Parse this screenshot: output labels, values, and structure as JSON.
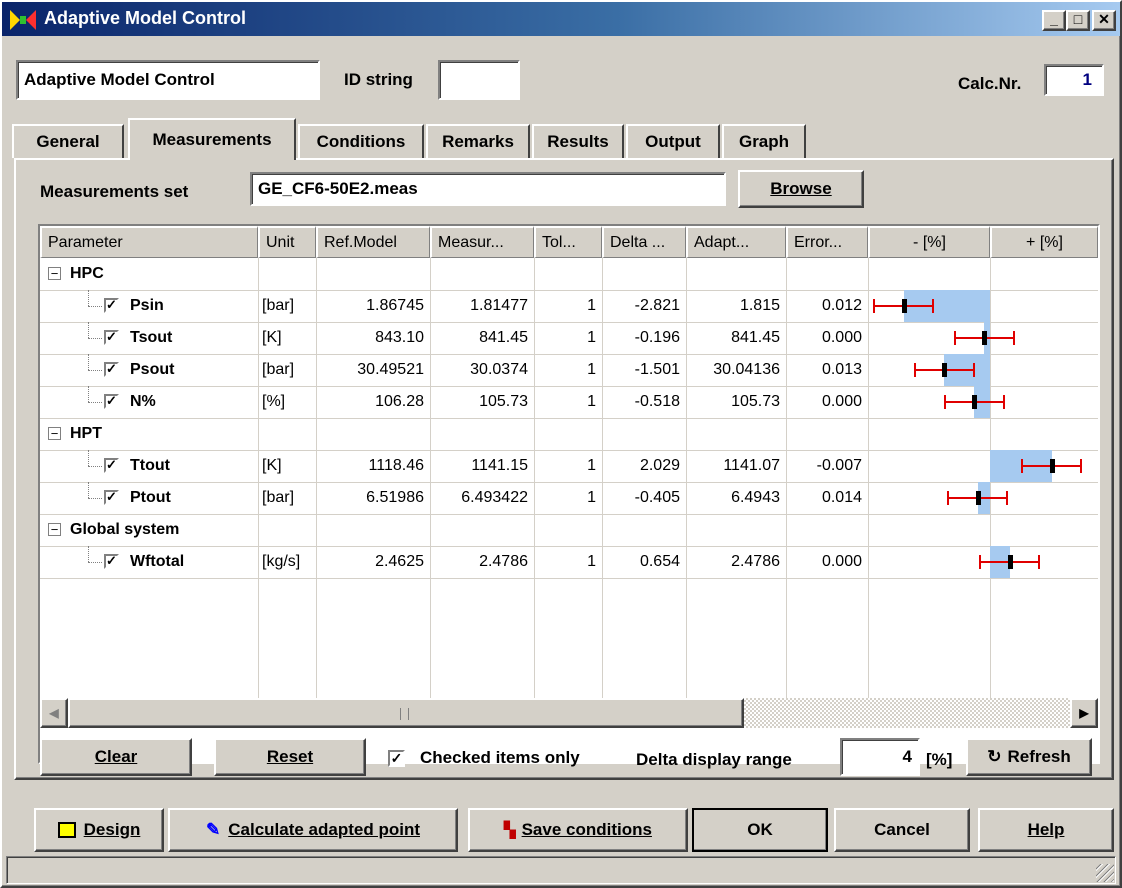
{
  "window": {
    "title": "Adaptive Model Control"
  },
  "header": {
    "name_value": "Adaptive Model Control",
    "id_label": "ID string",
    "id_value": "",
    "calc_label": "Calc.Nr.",
    "calc_value": "1"
  },
  "tabs": [
    "General",
    "Measurements",
    "Conditions",
    "Remarks",
    "Results",
    "Output",
    "Graph"
  ],
  "measurements": {
    "set_label": "Measurements set",
    "set_value": "GE_CF6-50E2.meas",
    "browse_label": "Browse"
  },
  "grid": {
    "columns": [
      "Parameter",
      "Unit",
      "Ref.Model",
      "Measur...",
      "Tol...",
      "Delta ...",
      "Adapt...",
      "Error...",
      "- [%]",
      "+ [%]"
    ],
    "groups": [
      {
        "name": "HPC",
        "rows": [
          {
            "param": "Psin",
            "unit": "[bar]",
            "ref": "1.86745",
            "meas": "1.81477",
            "tol": "1",
            "delta": "-2.821",
            "adapt": "1.815",
            "error": "0.012"
          },
          {
            "param": "Tsout",
            "unit": "[K]",
            "ref": "843.10",
            "meas": "841.45",
            "tol": "1",
            "delta": "-0.196",
            "adapt": "841.45",
            "error": "0.000"
          },
          {
            "param": "Psout",
            "unit": "[bar]",
            "ref": "30.49521",
            "meas": "30.0374",
            "tol": "1",
            "delta": "-1.501",
            "adapt": "30.04136",
            "error": "0.013"
          },
          {
            "param": "N%",
            "unit": "[%]",
            "ref": "106.28",
            "meas": "105.73",
            "tol": "1",
            "delta": "-0.518",
            "adapt": "105.73",
            "error": "0.000"
          }
        ]
      },
      {
        "name": "HPT",
        "rows": [
          {
            "param": "Ttout",
            "unit": "[K]",
            "ref": "1118.46",
            "meas": "1141.15",
            "tol": "1",
            "delta": "2.029",
            "adapt": "1141.07",
            "error": "-0.007"
          },
          {
            "param": "Ptout",
            "unit": "[bar]",
            "ref": "6.51986",
            "meas": "6.493422",
            "tol": "1",
            "delta": "-0.405",
            "adapt": "6.4943",
            "error": "0.014"
          }
        ]
      },
      {
        "name": "Global system",
        "rows": [
          {
            "param": "Wftotal",
            "unit": "[kg/s]",
            "ref": "2.4625",
            "meas": "2.4786",
            "tol": "1",
            "delta": "0.654",
            "adapt": "2.4786",
            "error": "0.000"
          }
        ]
      }
    ]
  },
  "controls": {
    "clear": "Clear",
    "reset": "Reset",
    "checked_only_label": "Checked items only",
    "checked_only": true,
    "delta_range_label": "Delta display range",
    "delta_range_value": "4",
    "delta_range_unit": "[%]",
    "refresh": "Refresh"
  },
  "footer": {
    "design": "Design",
    "calculate": "Calculate adapted point",
    "save": "Save conditions",
    "ok": "OK",
    "cancel": "Cancel",
    "help": "Help"
  },
  "colors": {
    "bar": "#a6caf0",
    "error_bar": "#e00000",
    "title_start": "#0a246a",
    "title_end": "#a6caf0",
    "calc_value": "#000080"
  }
}
